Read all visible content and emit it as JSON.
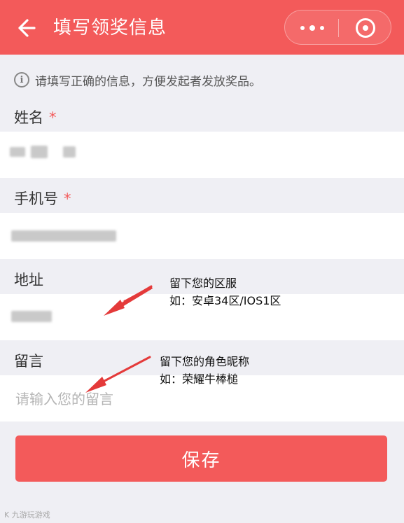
{
  "header": {
    "title": "填写领奖信息",
    "background": "#f35a5a"
  },
  "tip": {
    "icon": "info-icon",
    "icon_glyph": "i",
    "text": "请填写正确的信息，方便发起者发放奖品。"
  },
  "form": {
    "name": {
      "label": "姓名",
      "required_mark": "*"
    },
    "phone": {
      "label": "手机号",
      "required_mark": "*"
    },
    "address": {
      "label": "地址"
    },
    "message": {
      "label": "留言",
      "placeholder": "请输入您的留言"
    }
  },
  "annotations": {
    "address_note_line1": "留下您的区服",
    "address_note_line2": "如：安卓34区/IOS1区",
    "message_note_line1": "留下您的角色昵称",
    "message_note_line2": "如：荣耀牛棒槌"
  },
  "save_button": {
    "label": "保存"
  },
  "watermark": {
    "text": "K 九游玩游戏"
  },
  "colors": {
    "accent": "#f35a5a",
    "page_bg": "#efeff4",
    "annotation_arrow": "#e43a3a"
  }
}
